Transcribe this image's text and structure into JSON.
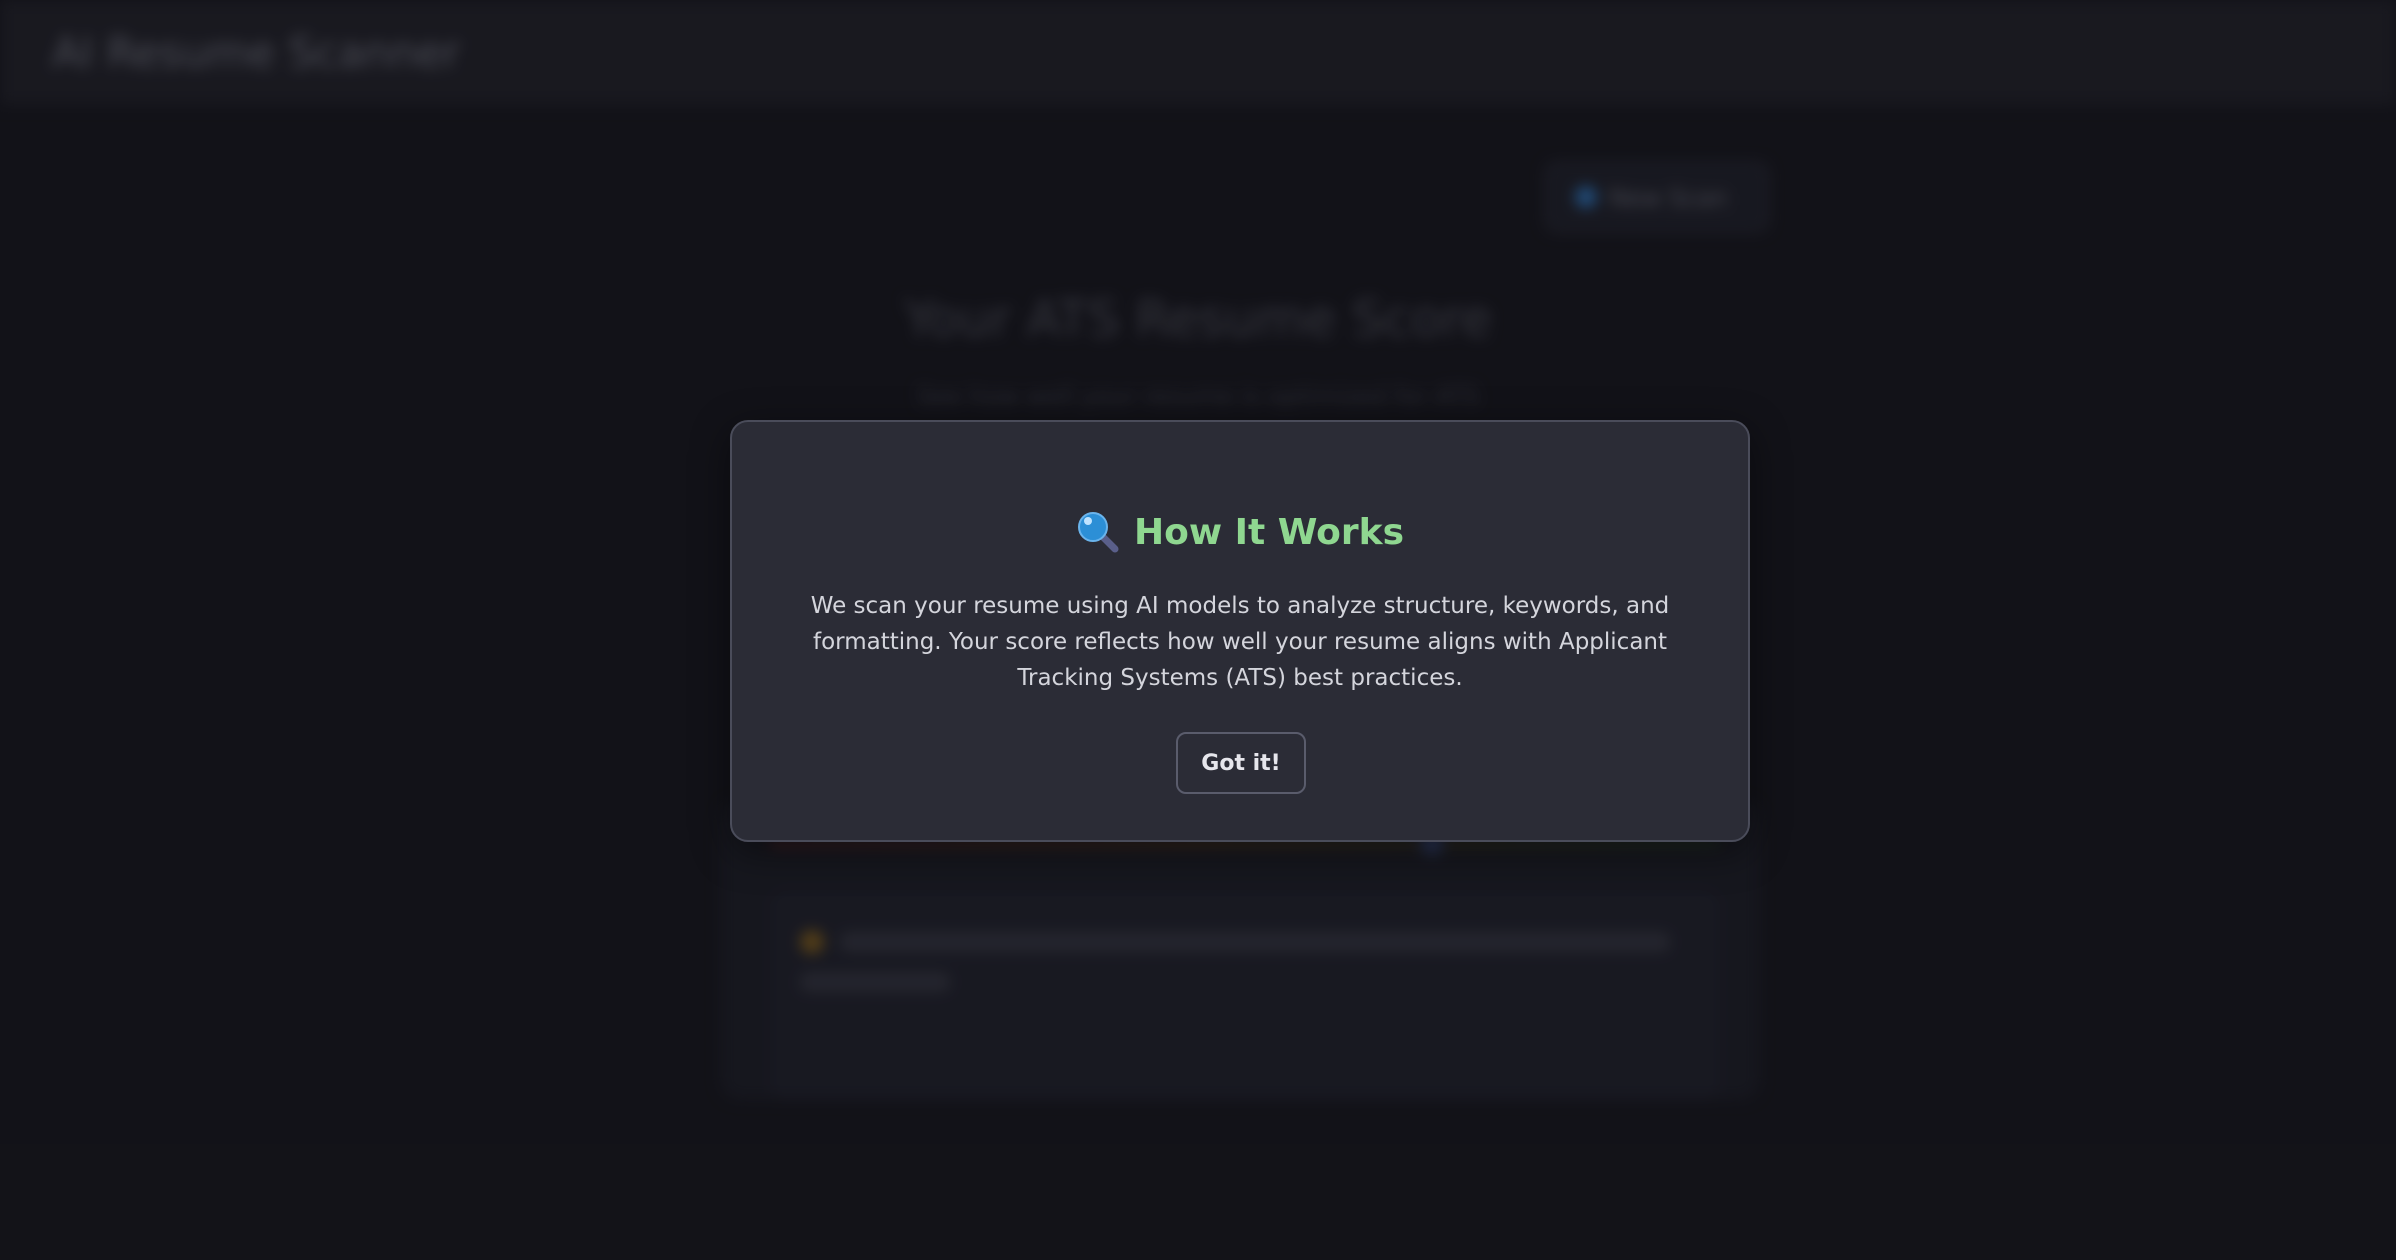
{
  "app": {
    "title": "AI Resume Scanner"
  },
  "background": {
    "header_button_label": "New Scan",
    "page_heading": "Your ATS Resume Score",
    "page_subheading": "See how well your resume is optimized for ATS"
  },
  "modal": {
    "icon": "magnifier-icon",
    "title": "How It Works",
    "body": "We scan your resume using AI models to analyze structure, keywords, and formatting. Your score reflects how well your resume aligns with Applicant Tracking Systems (ATS) best practices.",
    "button_label": "Got it!"
  },
  "colors": {
    "title_accent": "#8fd790",
    "modal_background": "#2b2c36",
    "page_background": "#18181e"
  }
}
